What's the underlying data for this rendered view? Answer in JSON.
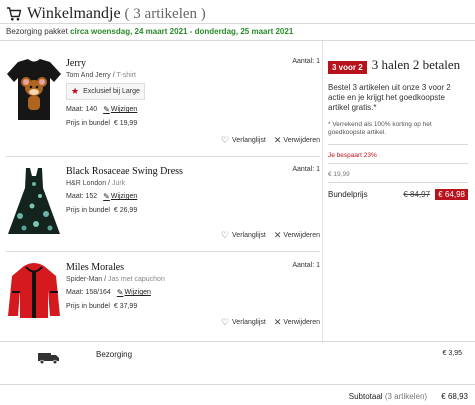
{
  "header": {
    "title": "Winkelmandje",
    "count": "( 3 artikelen )",
    "cart_icon": "cart-icon"
  },
  "delivery": {
    "prefix": "Bezorging pakket",
    "dates": "circa woensdag, 24 maart 2021 - donderdag, 25 maart 2021"
  },
  "items": [
    {
      "name": "Jerry",
      "brand": "Tom And Jerry",
      "category": "T-shirt",
      "exclusive": "Exclusief bij Large",
      "size_label": "Maat: 140",
      "edit_label": "Wijzigen",
      "price_label": "Prijs in bundel",
      "price": "€ 19,99",
      "qty": "Aantal: 1",
      "wishlist_label": "Verlanglijst",
      "remove_label": "Verwijderen"
    },
    {
      "name": "Black Rosaceae Swing Dress",
      "brand": "H&R London",
      "category": "Jurk",
      "size_label": "Maat: 152",
      "edit_label": "Wijzigen",
      "price_label": "Prijs in bundel",
      "price": "€ 26,99",
      "qty": "Aantal: 1",
      "wishlist_label": "Verlanglijst",
      "remove_label": "Verwijderen"
    },
    {
      "name": "Miles Morales",
      "brand": "Spider-Man",
      "category": "Jas met capuchon",
      "size_label": "Maat: 158/164",
      "edit_label": "Wijzigen",
      "price_label": "Prijs in bundel",
      "price": "€ 37,99",
      "qty": "Aantal: 1",
      "wishlist_label": "Verlanglijst",
      "remove_label": "Verwijderen"
    }
  ],
  "promo": {
    "badge": "3 voor 2",
    "title": "3 halen 2 betalen",
    "description": "Bestel 3 artikelen uit onze 3 voor 2 actie en je krijgt het goedkoopste artikel gratis.*",
    "note": "* Verrekend als 100% korting op het goedkoopste artikel.",
    "saving": "Je bespaart 23%",
    "saving_amount": "€ 19,99",
    "bundle_label": "Bundelprijs",
    "old_price": "€ 84,97",
    "new_price": "€ 64,98"
  },
  "shipping": {
    "label": "Bezorging",
    "price": "€ 3,95",
    "icon": "truck-icon"
  },
  "subtotal": {
    "label": "Subtotaal",
    "count": "(3 artikelen)",
    "amount": "€ 68,93"
  },
  "colors": {
    "accent_red": "#b8121c",
    "delivery_green": "#2a8a2a"
  }
}
